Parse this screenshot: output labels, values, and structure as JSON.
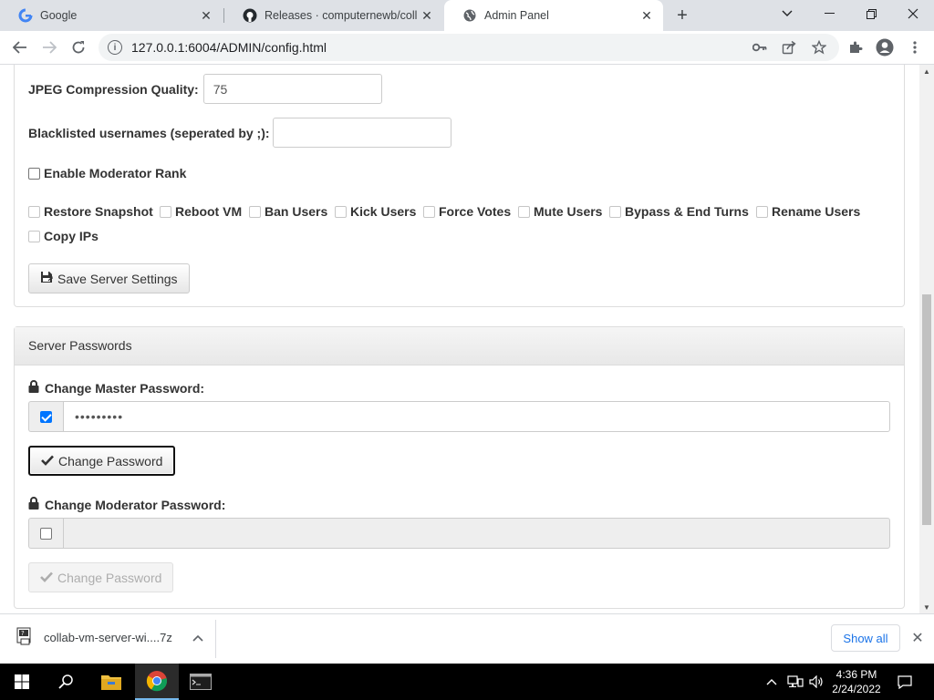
{
  "browser": {
    "tabs": [
      {
        "title": "Google",
        "icon": "google-icon"
      },
      {
        "title": "Releases · computernewb/collab",
        "icon": "github-icon"
      },
      {
        "title": "Admin Panel",
        "icon": "globe-icon"
      }
    ],
    "url": "127.0.0.1:6004/ADMIN/config.html"
  },
  "server_settings": {
    "jpeg_label": "JPEG Compression Quality:",
    "jpeg_value": "75",
    "blacklist_label": "Blacklisted usernames (seperated by ;):",
    "blacklist_value": "",
    "moderator_rank_label": "Enable Moderator Rank",
    "permissions": [
      "Restore Snapshot",
      "Reboot VM",
      "Ban Users",
      "Kick Users",
      "Force Votes",
      "Mute Users",
      "Bypass & End Turns",
      "Rename Users",
      "Copy IPs"
    ],
    "save_label": "Save Server Settings"
  },
  "server_passwords": {
    "heading": "Server Passwords",
    "master_label": "Change Master Password:",
    "master_value": "•••••••••",
    "master_checked": true,
    "master_button": "Change Password",
    "moderator_label": "Change Moderator Password:",
    "moderator_value": "",
    "moderator_checked": false,
    "moderator_button": "Change Password"
  },
  "downloads": {
    "filename": "collab-vm-server-wi....7z",
    "show_all": "Show all"
  },
  "taskbar": {
    "time": "4:36 PM",
    "date": "2/24/2022"
  },
  "colors": {
    "accent": "#0075ff",
    "link": "#1a73e8",
    "tab_strip": "#dee1e6"
  }
}
